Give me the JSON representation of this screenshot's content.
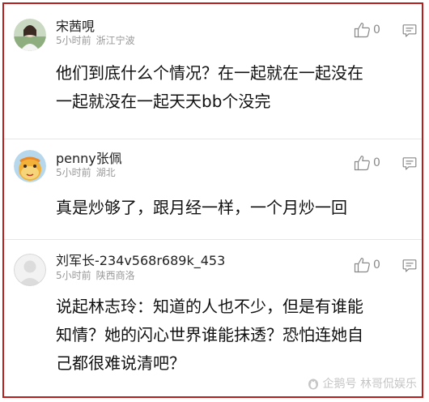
{
  "comments": [
    {
      "username": "宋茜哯",
      "time": "5小时前",
      "location": "浙江宁波",
      "likes": "0",
      "content": "他们到底什么个情况？在一起就在一起没在\n一起就没在一起天天bb个没完",
      "avatar": "photo-avatar-icon"
    },
    {
      "username": "penny张佩",
      "time": "5小时前",
      "location": "湖北",
      "likes": "0",
      "content": "真是炒够了，跟月经一样，一个月炒一回",
      "avatar": "cartoon-avatar-icon"
    },
    {
      "username": "刘军长-234v568r689k_453",
      "time": "5小时前",
      "location": "陕西商洛",
      "likes": "0",
      "content": "说起林志玲：知道的人也不少，但是有谁能\n知情？她的闪心世界谁能抹透？恐怕连她自\n己都很难说清吧？",
      "avatar": "default-avatar-icon"
    }
  ],
  "watermark": "企鹅号 林哥侃娱乐",
  "colors": {
    "frame_border": "#b71f1f",
    "meta_text": "#999999",
    "body_text": "#111111"
  }
}
